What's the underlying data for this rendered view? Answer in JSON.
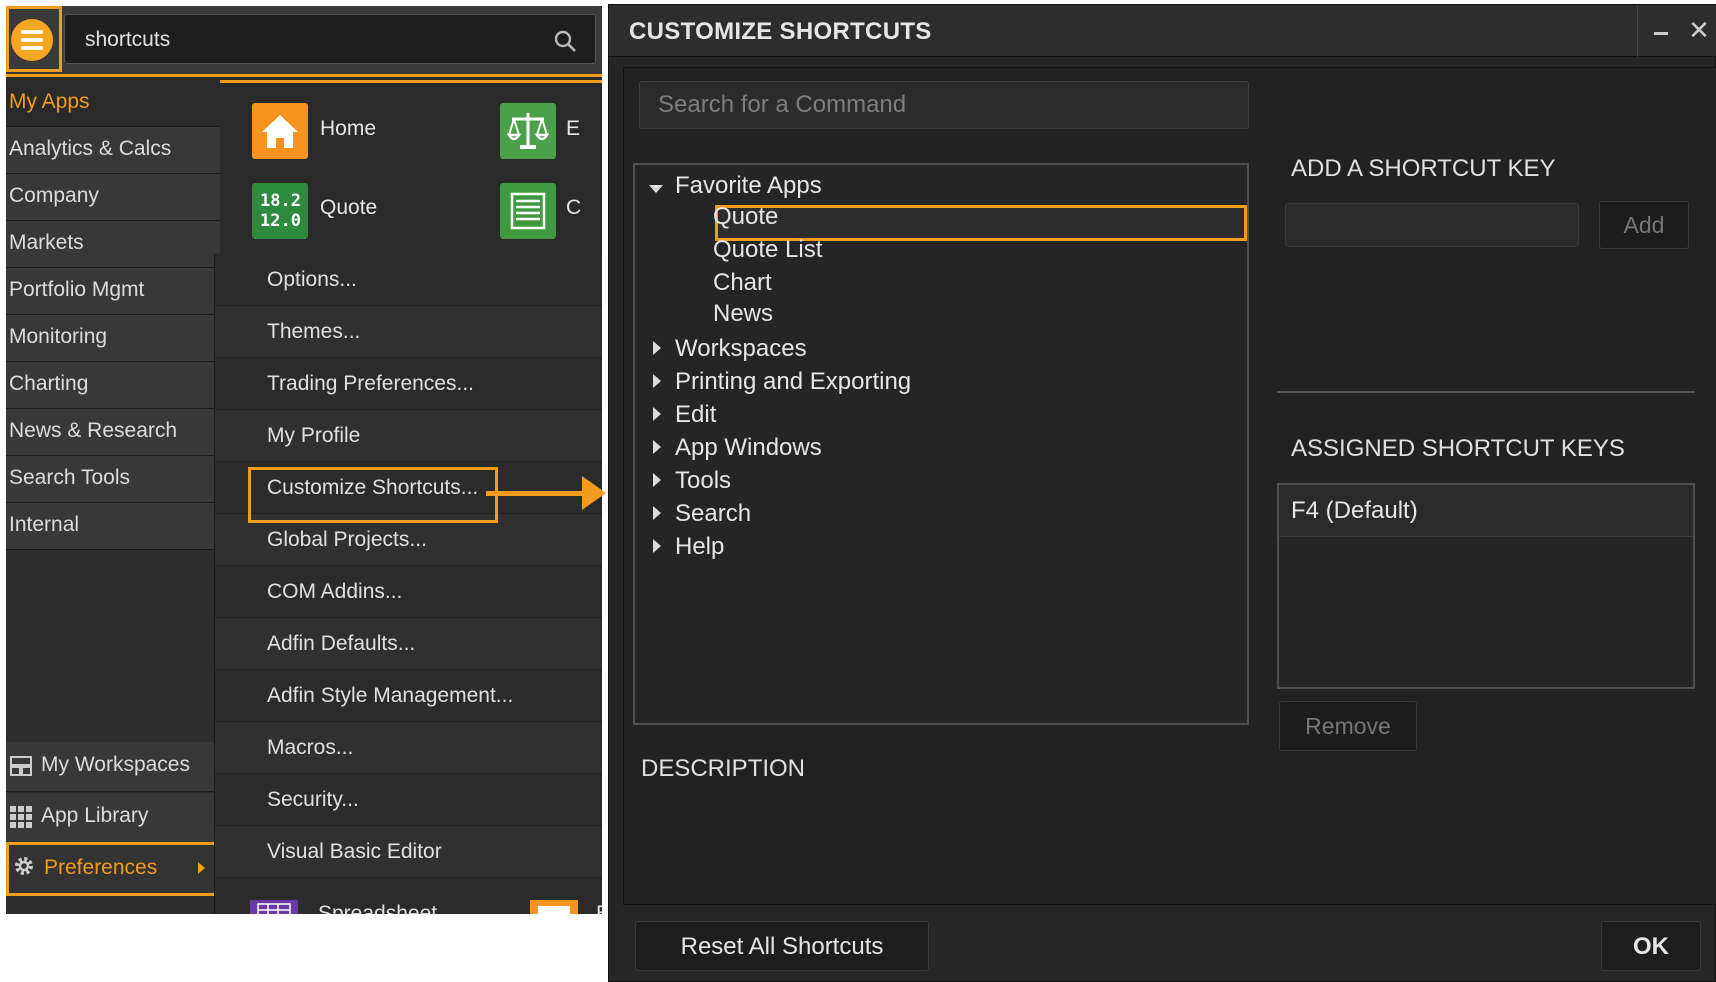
{
  "theme": {
    "accent": "#f39b1c",
    "panel_bg": "#2a2a2a",
    "dialog_bg": "#222222"
  },
  "launcher": {
    "logo_icon": "menu-circle-icon",
    "search": {
      "value": "shortcuts",
      "icon": "search-icon"
    },
    "nav_items": [
      {
        "label": "My Apps",
        "active": true
      },
      {
        "label": "Analytics & Calcs"
      },
      {
        "label": "Company"
      },
      {
        "label": "Markets"
      },
      {
        "label": "Portfolio Mgmt"
      },
      {
        "label": "Monitoring"
      },
      {
        "label": "Charting"
      },
      {
        "label": "News & Research"
      },
      {
        "label": "Search Tools"
      },
      {
        "label": "Internal"
      }
    ],
    "nav_bottom": [
      {
        "label": "My Workspaces",
        "icon": "workspaces-icon"
      },
      {
        "label": "App Library",
        "icon": "grid-icon"
      },
      {
        "label": "Preferences",
        "icon": "gear-icon",
        "highlighted": true
      }
    ],
    "apps": [
      {
        "label": "Home",
        "icon": "home-icon",
        "color": "#f7931e"
      },
      {
        "label": "Quote",
        "icon": "quote-icon",
        "color": "#2e8b3e",
        "tile_text": [
          "18.2",
          "12.0"
        ]
      },
      {
        "label": "E",
        "icon": "scales-icon",
        "color": "#4aa14a"
      },
      {
        "label": "C",
        "icon": "list-icon",
        "color": "#3f9a3f"
      }
    ],
    "submenu": [
      {
        "label": "Options..."
      },
      {
        "label": "Themes..."
      },
      {
        "label": "Trading Preferences..."
      },
      {
        "label": "My Profile"
      },
      {
        "label": "Customize Shortcuts...",
        "highlighted": true
      },
      {
        "label": "Global Projects..."
      },
      {
        "label": "COM Addins..."
      },
      {
        "label": "Adfin Defaults..."
      },
      {
        "label": "Adfin Style Management..."
      },
      {
        "label": "Macros..."
      },
      {
        "label": "Security..."
      },
      {
        "label": "Visual Basic Editor"
      }
    ],
    "partial_app": {
      "label": "Spreadsheet",
      "cut_letter": "E"
    }
  },
  "dialog": {
    "title": "CUSTOMIZE SHORTCUTS",
    "search_placeholder": "Search for a Command",
    "tree": {
      "groups": [
        {
          "label": "Favorite Apps",
          "expanded": true,
          "children": [
            "Quote",
            "Quote List",
            "Chart",
            "News"
          ],
          "selected": "Quote"
        },
        {
          "label": "Workspaces"
        },
        {
          "label": "Printing and Exporting"
        },
        {
          "label": "Edit"
        },
        {
          "label": "App Windows"
        },
        {
          "label": "Tools"
        },
        {
          "label": "Search"
        },
        {
          "label": "Help"
        }
      ]
    },
    "description_label": "DESCRIPTION",
    "add_shortcut_label": "ADD A SHORTCUT KEY",
    "add_button": "Add",
    "assigned_label": "ASSIGNED SHORTCUT KEYS",
    "assigned_keys": [
      "F4 (Default)"
    ],
    "remove_button": "Remove",
    "reset_button": "Reset All Shortcuts",
    "ok_button": "OK",
    "minimize_glyph": "–",
    "close_glyph": "✕"
  }
}
